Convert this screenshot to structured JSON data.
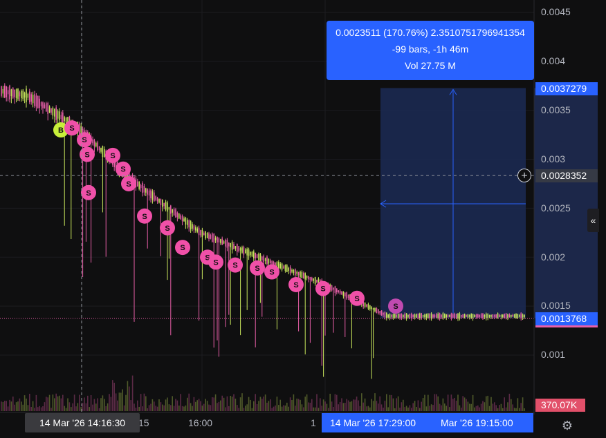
{
  "colors": {
    "background": "#0f0f10",
    "up": "#c8e65c",
    "down": "#e85fa8",
    "sell_marker": "#f050a8",
    "buy_marker": "#c8f03a",
    "accent": "#2962ff",
    "range_fill": "#1b2a55",
    "last_price_tag": "#2962ff",
    "volume_tag": "#e2506a"
  },
  "price_axis": {
    "labels": [
      "0.0045",
      "0.004",
      "0.0035",
      "0.003",
      "0.0025",
      "0.002",
      "0.0015",
      "0.001"
    ],
    "values": [
      0.0045,
      0.004,
      0.0035,
      0.003,
      0.0025,
      0.002,
      0.0015,
      0.001
    ]
  },
  "price_tags": {
    "range_top": "0.0037279",
    "crosshair": "0.0028352",
    "last_price": "0.0013768",
    "volume": "370.07K"
  },
  "time_axis": {
    "labels": [
      "15",
      "16:00",
      "1"
    ]
  },
  "crosshair_time": "14 Mar '26   14:16:30",
  "range_time": {
    "start": "14 Mar '26   17:29:00",
    "end": "Mar '26   19:15:00"
  },
  "tooltip": {
    "line1": "0.0023511 (170.76%) 2.3510751796941354",
    "line2": "-99 bars, -1h 46m",
    "line3": "Vol 27.75 M"
  },
  "buttons": {
    "plus": "+",
    "collapse": "«",
    "settings": "⚙"
  },
  "chart_data": {
    "type": "candlestick",
    "ylim": [
      0.0006,
      0.0046
    ],
    "price_approx": {
      "x": [
        "14:00",
        "14:16:30",
        "15:00",
        "16:00",
        "17:00",
        "17:29",
        "18:00",
        "19:15"
      ],
      "y": [
        0.0036,
        0.0033,
        0.0027,
        0.0023,
        0.0019,
        0.0016,
        0.0014,
        0.0014
      ]
    },
    "markers": [
      {
        "type": "B",
        "price": 0.0033
      },
      {
        "type": "S",
        "price": 0.00332
      },
      {
        "type": "S",
        "price": 0.0032
      },
      {
        "type": "S",
        "price": 0.00305
      },
      {
        "type": "S",
        "price": 0.00304
      },
      {
        "type": "S",
        "price": 0.0029
      },
      {
        "type": "S",
        "price": 0.00275
      },
      {
        "type": "S",
        "price": 0.00266
      },
      {
        "type": "S",
        "price": 0.00242
      },
      {
        "type": "S",
        "price": 0.0023
      },
      {
        "type": "S",
        "price": 0.0021
      },
      {
        "type": "S",
        "price": 0.002
      },
      {
        "type": "S",
        "price": 0.00195
      },
      {
        "type": "S",
        "price": 0.00192
      },
      {
        "type": "S",
        "price": 0.00189
      },
      {
        "type": "S",
        "price": 0.00185
      },
      {
        "type": "S",
        "price": 0.00172
      },
      {
        "type": "S",
        "price": 0.00168
      },
      {
        "type": "S",
        "price": 0.00158
      },
      {
        "type": "S",
        "price": 0.0015
      }
    ],
    "measure_range": {
      "from_price": 0.0013768,
      "to_price": 0.0037279,
      "change": "0.0023511 (170.76%)",
      "bars": -99,
      "duration": "-1h 46m",
      "volume": "27.75 M"
    },
    "crosshair_price": 0.0028352,
    "last_price": 0.0013768
  }
}
